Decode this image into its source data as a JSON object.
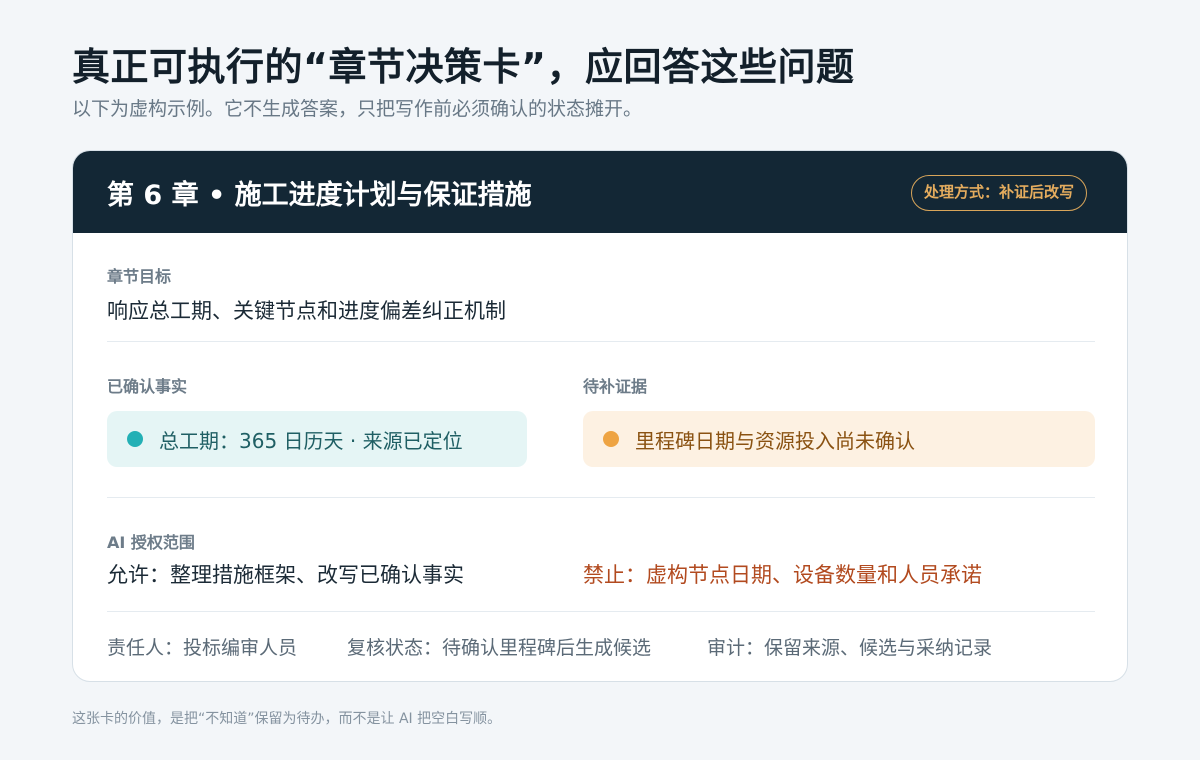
{
  "page": {
    "title": "真正可执行的“章节决策卡”，应回答这些问题",
    "subtitle": "以下为虚构示例。它不生成答案，只把写作前必须确认的状态摊开。",
    "footnote": "这张卡的价值，是把“不知道”保留为待办，而不是让 AI 把空白写顺。"
  },
  "card": {
    "title": "第 6 章 • 施工进度计划与保证措施",
    "handling_badge": "处理方式：补证后改写",
    "goal": {
      "label": "章节目标",
      "text": "响应总工期、关键节点和进度偏差纠正机制"
    },
    "confirmed": {
      "label": "已确认事实",
      "text": "总工期：365 日历天 · 来源已定位",
      "dot_color": "#23b0b5",
      "text_color": "#1f5f64"
    },
    "pending": {
      "label": "待补证据",
      "text": "里程碑日期与资源投入尚未确认",
      "dot_color": "#eea443",
      "text_color": "#8a5212"
    },
    "ai_scope": {
      "label": "AI 授权范围",
      "allowed": "允许：整理措施框架、改写已确认事实",
      "forbidden": "禁止：虚构节点日期、设备数量和人员承诺",
      "forbidden_color": "#b24a1f"
    },
    "footer": {
      "owner": "责任人：投标编审人员",
      "review": "复核状态：待确认里程碑后生成候选",
      "audit": "审计：保留来源、候选与采纳记录"
    }
  },
  "colors": {
    "header_bg": "#132735",
    "badge_accent": "#d8a55a"
  }
}
